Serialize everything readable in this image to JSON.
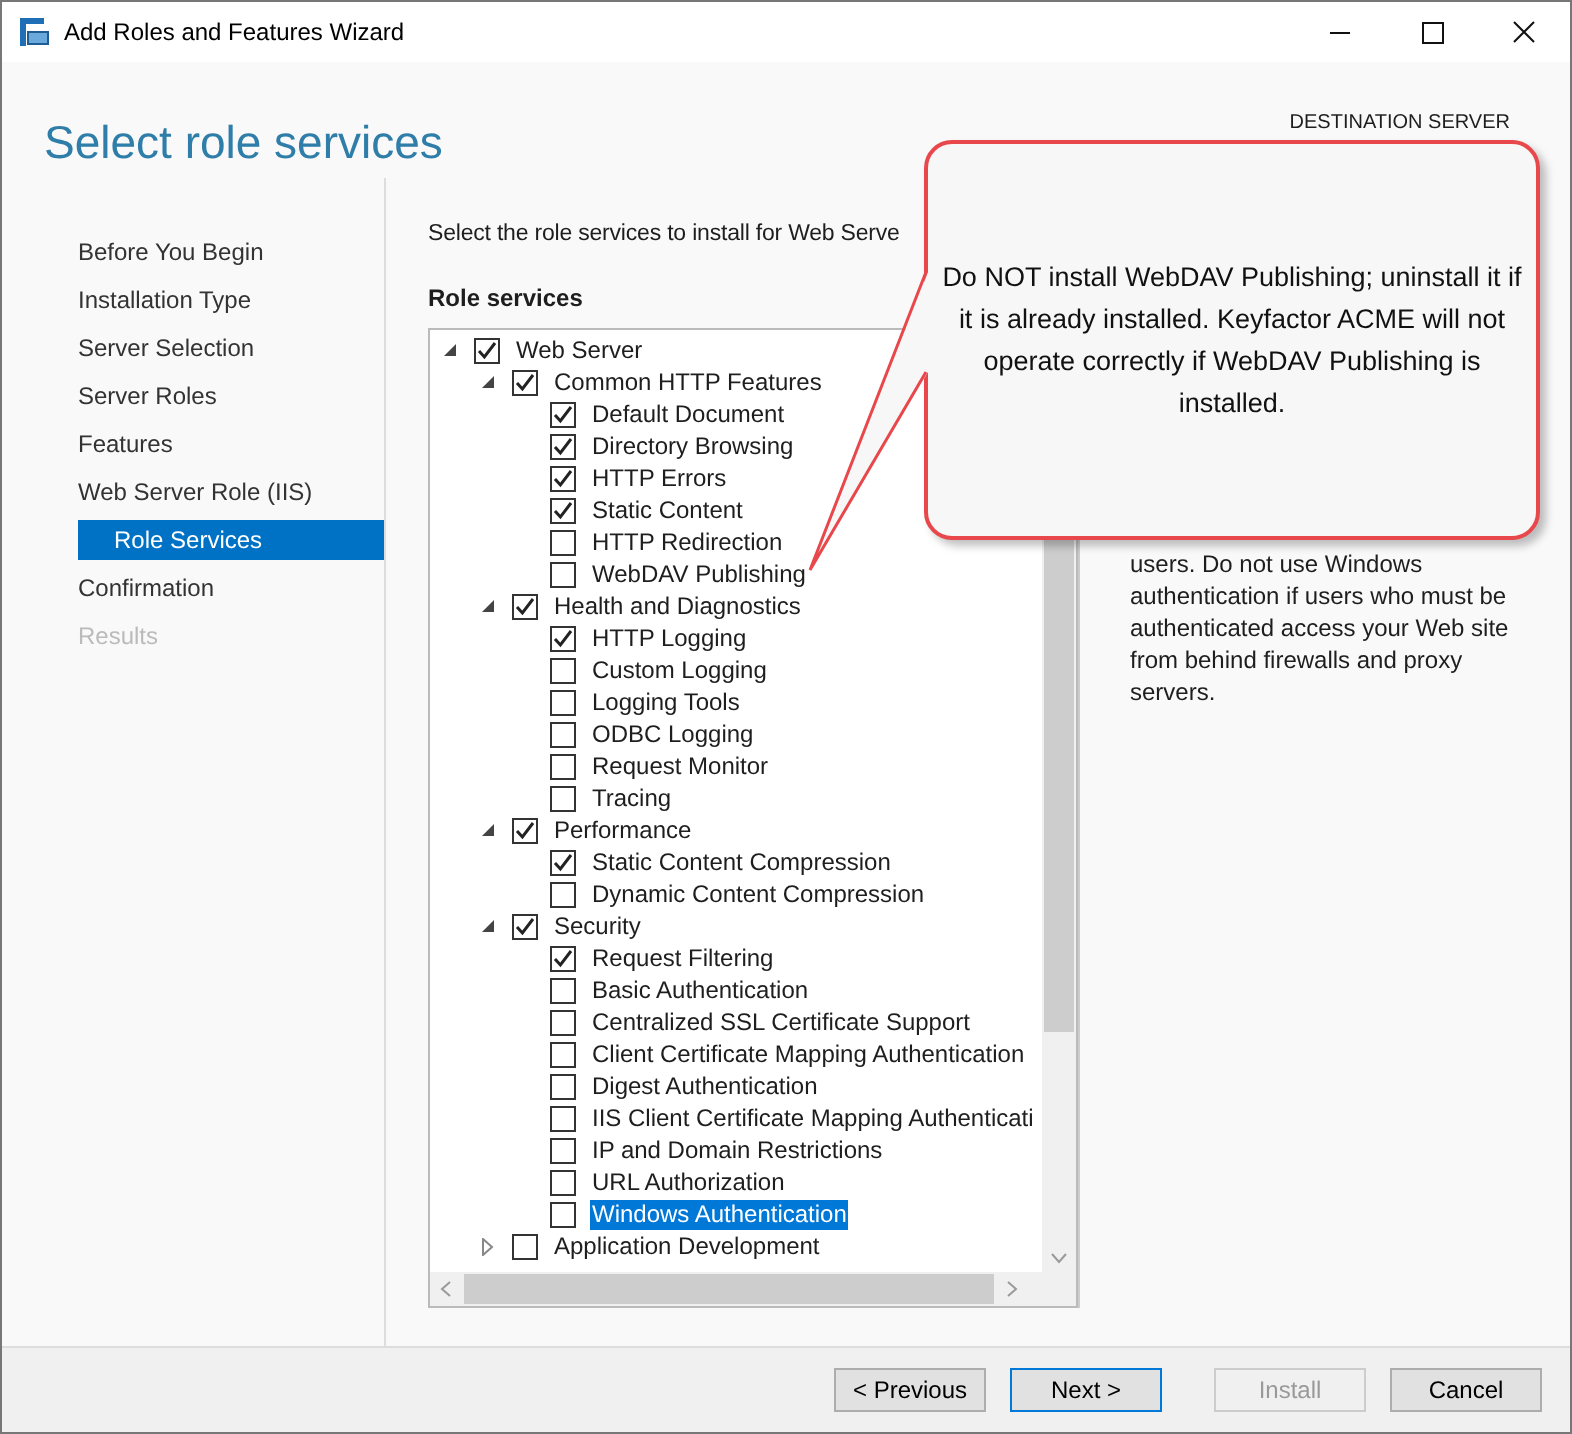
{
  "window": {
    "title": "Add Roles and Features Wizard"
  },
  "page_title": "Select role services",
  "destination_label": "DESTINATION SERVER",
  "steps": [
    {
      "label": "Before You Begin",
      "selected": false,
      "disabled": false
    },
    {
      "label": "Installation Type",
      "selected": false,
      "disabled": false
    },
    {
      "label": "Server Selection",
      "selected": false,
      "disabled": false
    },
    {
      "label": "Server Roles",
      "selected": false,
      "disabled": false
    },
    {
      "label": "Features",
      "selected": false,
      "disabled": false
    },
    {
      "label": "Web Server Role (IIS)",
      "selected": false,
      "disabled": false,
      "children": [
        {
          "label": "Role Services",
          "selected": true,
          "disabled": false
        }
      ]
    },
    {
      "label": "Confirmation",
      "selected": false,
      "disabled": false
    },
    {
      "label": "Results",
      "selected": false,
      "disabled": true
    }
  ],
  "instruction": "Select the role services to install for Web Serve",
  "list_heading": "Role services",
  "tree": [
    {
      "label": "Web Server",
      "checked": true,
      "expanded": true,
      "selected": false,
      "children": [
        {
          "label": "Common HTTP Features",
          "checked": true,
          "expanded": true,
          "selected": false,
          "children": [
            {
              "label": "Default Document",
              "checked": true,
              "selected": false
            },
            {
              "label": "Directory Browsing",
              "checked": true,
              "selected": false
            },
            {
              "label": "HTTP Errors",
              "checked": true,
              "selected": false
            },
            {
              "label": "Static Content",
              "checked": true,
              "selected": false
            },
            {
              "label": "HTTP Redirection",
              "checked": false,
              "selected": false
            },
            {
              "label": "WebDAV Publishing",
              "checked": false,
              "selected": false
            }
          ]
        },
        {
          "label": "Health and Diagnostics",
          "checked": true,
          "expanded": true,
          "selected": false,
          "children": [
            {
              "label": "HTTP Logging",
              "checked": true,
              "selected": false
            },
            {
              "label": "Custom Logging",
              "checked": false,
              "selected": false
            },
            {
              "label": "Logging Tools",
              "checked": false,
              "selected": false
            },
            {
              "label": "ODBC Logging",
              "checked": false,
              "selected": false
            },
            {
              "label": "Request Monitor",
              "checked": false,
              "selected": false
            },
            {
              "label": "Tracing",
              "checked": false,
              "selected": false
            }
          ]
        },
        {
          "label": "Performance",
          "checked": true,
          "expanded": true,
          "selected": false,
          "children": [
            {
              "label": "Static Content Compression",
              "checked": true,
              "selected": false
            },
            {
              "label": "Dynamic Content Compression",
              "checked": false,
              "selected": false
            }
          ]
        },
        {
          "label": "Security",
          "checked": true,
          "expanded": true,
          "selected": false,
          "children": [
            {
              "label": "Request Filtering",
              "checked": true,
              "selected": false
            },
            {
              "label": "Basic Authentication",
              "checked": false,
              "selected": false
            },
            {
              "label": "Centralized SSL Certificate Support",
              "checked": false,
              "selected": false
            },
            {
              "label": "Client Certificate Mapping Authentication",
              "checked": false,
              "selected": false
            },
            {
              "label": "Digest Authentication",
              "checked": false,
              "selected": false
            },
            {
              "label": "IIS Client Certificate Mapping Authenticati",
              "checked": false,
              "selected": false
            },
            {
              "label": "IP and Domain Restrictions",
              "checked": false,
              "selected": false
            },
            {
              "label": "URL Authorization",
              "checked": false,
              "selected": false
            },
            {
              "label": "Windows Authentication",
              "checked": false,
              "selected": true
            }
          ]
        },
        {
          "label": "Application Development",
          "checked": false,
          "expanded": false,
          "selected": false
        }
      ]
    }
  ],
  "description": "users. Do not use Windows authentication if users who must be authenticated access your Web site from behind firewalls and proxy servers.",
  "callout": {
    "text": "Do NOT  install WebDAV Publishing; uninstall it if it is already installed. Keyfactor ACME will not operate correctly if WebDAV Publishing is installed."
  },
  "buttons": [
    {
      "label": "< Previous",
      "default": false,
      "disabled": false
    },
    {
      "label": "Next >",
      "default": true,
      "disabled": false
    },
    {
      "label": "Install",
      "default": false,
      "disabled": true
    },
    {
      "label": "Cancel",
      "default": false,
      "disabled": false
    }
  ]
}
